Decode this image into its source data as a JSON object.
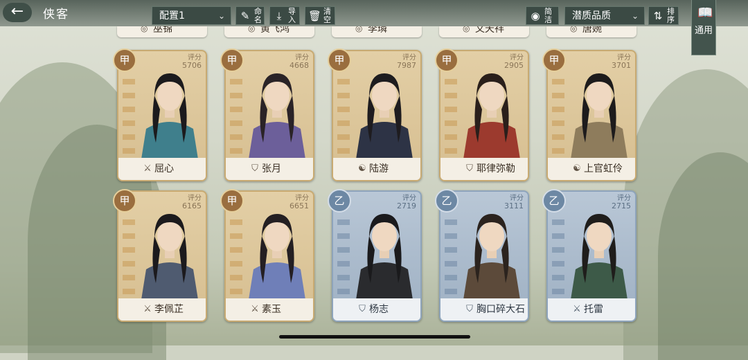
{
  "header": {
    "back_icon": "back-arrow-icon",
    "title": "侠客",
    "config_select": "配置1",
    "rename_label": "命名",
    "import_label": "导入",
    "clear_label": "清空",
    "simple_label": "简洁",
    "quality_select": "潜质品质",
    "sort_label": "排序",
    "general_label": "通用"
  },
  "top_partial_names": [
    "巫锦",
    "黄飞鸿",
    "李璘",
    "文天祥",
    "唐婉"
  ],
  "cards": [
    {
      "name": "屈心",
      "tier": "甲",
      "score_label": "评分",
      "score": "5706",
      "class_icon": "sword-icon"
    },
    {
      "name": "张月",
      "tier": "甲",
      "score_label": "评分",
      "score": "4668",
      "class_icon": "shield-icon"
    },
    {
      "name": "陆游",
      "tier": "甲",
      "score_label": "评分",
      "score": "7987",
      "class_icon": "taiji-icon"
    },
    {
      "name": "耶律弥勒",
      "tier": "甲",
      "score_label": "评分",
      "score": "2905",
      "class_icon": "shield-icon"
    },
    {
      "name": "上官虹伶",
      "tier": "甲",
      "score_label": "评分",
      "score": "3701",
      "class_icon": "taiji-icon"
    },
    {
      "name": "李佩芷",
      "tier": "甲",
      "score_label": "评分",
      "score": "6165",
      "class_icon": "sword-icon"
    },
    {
      "name": "素玉",
      "tier": "甲",
      "score_label": "评分",
      "score": "6651",
      "class_icon": "sword-icon"
    },
    {
      "name": "杨志",
      "tier": "乙",
      "score_label": "评分",
      "score": "2719",
      "class_icon": "shield-icon"
    },
    {
      "name": "胸口碎大石",
      "tier": "乙",
      "score_label": "评分",
      "score": "3111",
      "class_icon": "shield-icon"
    },
    {
      "name": "托雷",
      "tier": "乙",
      "score_label": "评分",
      "score": "2715",
      "class_icon": "sword-icon"
    }
  ]
}
